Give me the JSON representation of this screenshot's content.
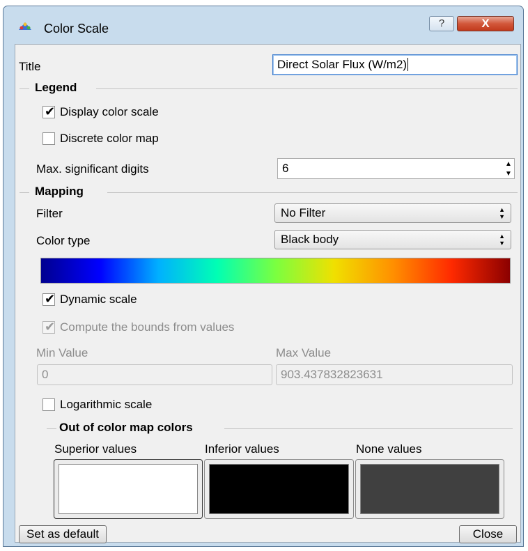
{
  "window": {
    "title": "Color Scale",
    "help_glyph": "?",
    "close_glyph": "X"
  },
  "title_row": {
    "label": "Title",
    "value": "Direct Solar Flux (W/m2)"
  },
  "legend": {
    "header": "Legend",
    "display_color_scale": {
      "label": "Display color scale",
      "checked": true
    },
    "discrete_color_map": {
      "label": "Discrete color map",
      "checked": false
    },
    "max_digits": {
      "label": "Max. significant digits",
      "value": "6"
    }
  },
  "mapping": {
    "header": "Mapping",
    "filter": {
      "label": "Filter",
      "value": "No Filter"
    },
    "color_type": {
      "label": "Color type",
      "value": "Black body"
    },
    "gradient_colors": [
      "#00008f",
      "#0000ff",
      "#00b0ff",
      "#00ffb4",
      "#7aff40",
      "#f0e000",
      "#ff9000",
      "#ff2a00",
      "#8b0000"
    ],
    "dynamic_scale": {
      "label": "Dynamic scale",
      "checked": true
    },
    "compute_bounds": {
      "label": "Compute the bounds from values",
      "checked": true,
      "enabled": false
    },
    "min_value": {
      "label": "Min Value",
      "value": "0"
    },
    "max_value": {
      "label": "Max Value",
      "value": "903.437832823631"
    },
    "logarithmic": {
      "label": "Logarithmic scale",
      "checked": false
    }
  },
  "out_of_map": {
    "header": "Out of color map colors",
    "superior": {
      "label": "Superior values",
      "color": "#ffffff"
    },
    "inferior": {
      "label": "Inferior values",
      "color": "#000000"
    },
    "none": {
      "label": "None values",
      "color": "#404040"
    }
  },
  "buttons": {
    "set_default": "Set as default",
    "close": "Close"
  }
}
